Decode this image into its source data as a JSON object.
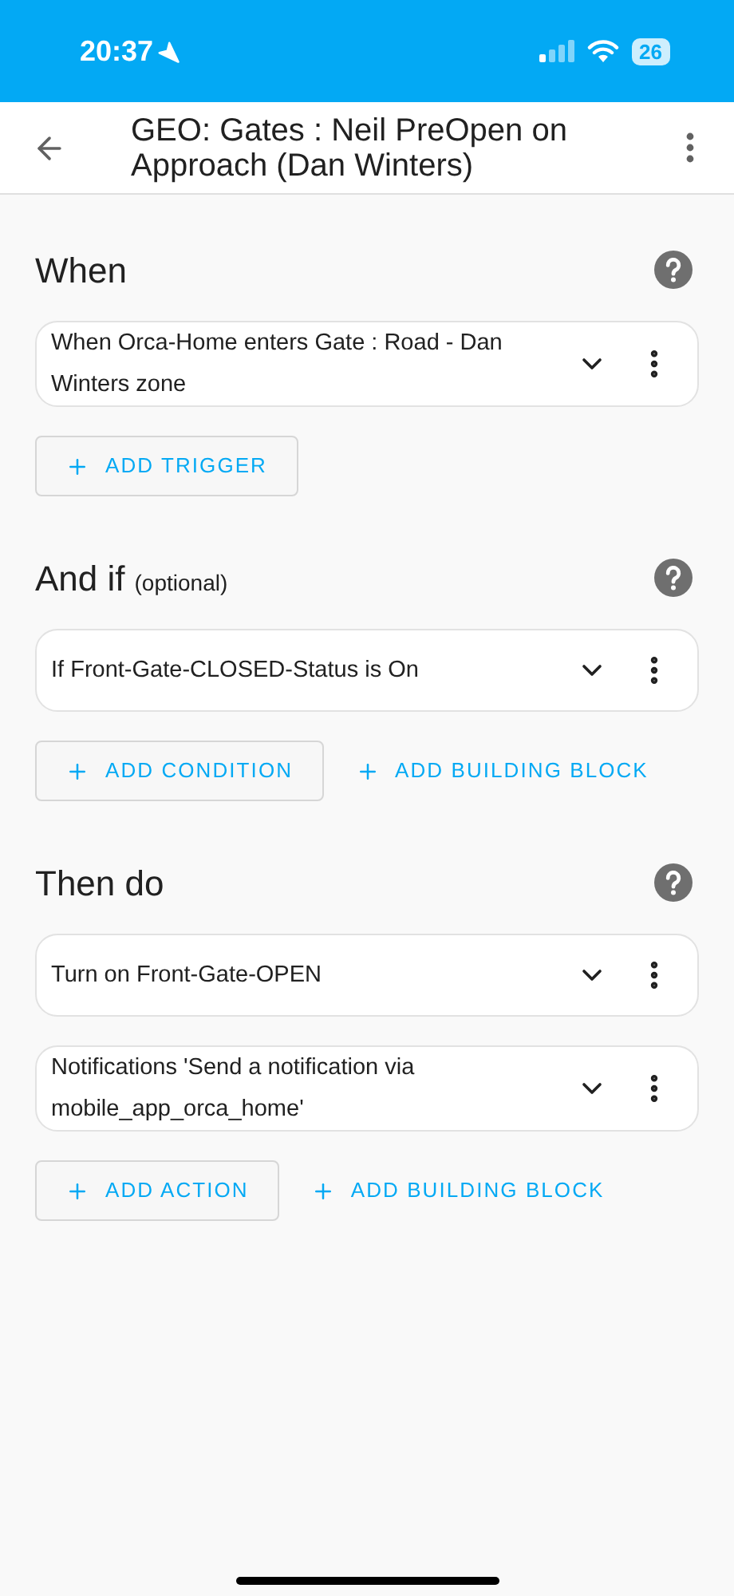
{
  "status_bar": {
    "time": "20:37",
    "battery": "26"
  },
  "header": {
    "title": "GEO: Gates : Neil PreOpen on Approach (Dan Winters)"
  },
  "sections": [
    {
      "title": "When",
      "items": [
        "When Orca-Home enters Gate : Road - Dan Winters zone"
      ],
      "buttons": [
        {
          "kind": "outlined",
          "label": "ADD TRIGGER"
        }
      ]
    },
    {
      "title": "And if",
      "note": "(optional)",
      "items": [
        "If Front-Gate-CLOSED-Status is On"
      ],
      "buttons": [
        {
          "kind": "outlined",
          "label": "ADD CONDITION"
        },
        {
          "kind": "text",
          "label": "ADD BUILDING BLOCK"
        }
      ]
    },
    {
      "title": "Then do",
      "items": [
        "Turn on Front-Gate-OPEN",
        "Notifications 'Send a notification via mobile_app_orca_home'"
      ],
      "buttons": [
        {
          "kind": "outlined",
          "label": "ADD ACTION"
        },
        {
          "kind": "text",
          "label": "ADD BUILDING BLOCK"
        }
      ]
    }
  ]
}
